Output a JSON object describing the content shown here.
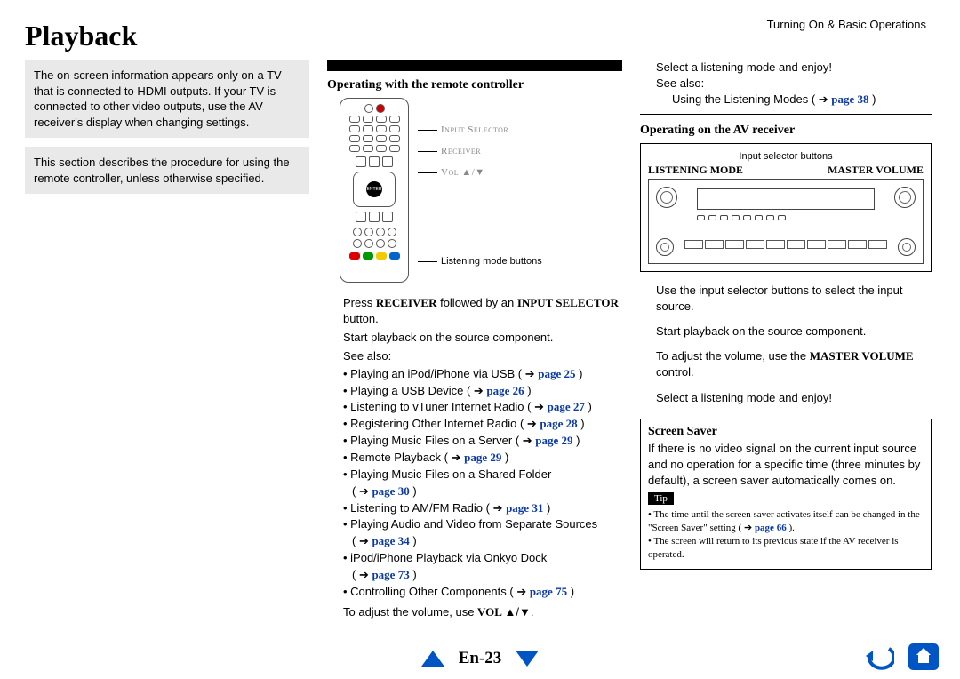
{
  "breadcrumb": "Turning On & Basic Operations",
  "title": "Playback",
  "notes": {
    "hdmi_info": "The on-screen information appears only on a TV that is connected to HDMI outputs. If your TV is connected to other video outputs, use the AV receiver's display when changing settings.",
    "procedure_intro": "This section describes the procedure for using the remote controller, unless otherwise specified."
  },
  "mid": {
    "heading": "Operating with the remote controller",
    "callouts": {
      "input_selector": "Input Selector",
      "receiver": "Receiver",
      "vol": "Vol ▲/▼",
      "listening_mode": "Listening mode buttons"
    },
    "step1_a": "Press ",
    "step1_b": "RECEIVER",
    "step1_c": " followed by an ",
    "step1_d": "INPUT SELECTOR",
    "step1_e": " button.",
    "step2": "Start playback on the source component.",
    "see_also_label": "See also:",
    "refs": [
      {
        "text": "Playing an iPod/iPhone via USB",
        "page": "page 25"
      },
      {
        "text": "Playing a USB Device",
        "page": "page 26"
      },
      {
        "text": "Listening to vTuner Internet Radio",
        "page": "page 27"
      },
      {
        "text": "Registering Other Internet Radio",
        "page": "page 28"
      },
      {
        "text": "Playing Music Files on a Server",
        "page": "page 29"
      },
      {
        "text": "Remote Playback",
        "page": "page 29"
      },
      {
        "text": "Playing Music Files on a Shared Folder",
        "page": "page 30"
      },
      {
        "text": "Listening to AM/FM Radio",
        "page": "page 31"
      },
      {
        "text": "Playing Audio and Video from Separate Sources",
        "page": "page 34"
      },
      {
        "text": "iPod/iPhone Playback via Onkyo Dock",
        "page": "page 73"
      },
      {
        "text": "Controlling Other Components",
        "page": "page 75"
      }
    ],
    "vol_a": "To adjust the volume, use ",
    "vol_b": "VOL ",
    "vol_c": "▲/▼",
    "vol_d": "."
  },
  "right": {
    "select_mode": "Select a listening mode and enjoy!",
    "see_also_label": "See also:",
    "listening_link_text": "Using the Listening Modes",
    "listening_link_page": "page 38",
    "section2_heading": "Operating on the AV receiver",
    "av_top_caption": "Input selector buttons",
    "av_left_label": "LISTENING MODE",
    "av_right_label": "MASTER VOLUME",
    "body1": "Use the input selector buttons to select the input source.",
    "body2": "Start playback on the source component.",
    "body3_a": "To adjust the volume, use the ",
    "body3_b": "MASTER VOLUME",
    "body3_c": " control.",
    "body4": "Select a listening mode and enjoy!",
    "screensaver_heading": "Screen Saver",
    "screensaver_body": "If there is no video signal on the current input source and no operation for a specific time (three minutes by default), a screen saver automatically comes on.",
    "tip_label": "Tip",
    "tip1_a": "The time until the screen saver activates itself can be changed in the \"Screen Saver\" setting",
    "tip1_page": "page 66",
    "tip2": "The screen will return to its previous state if the AV receiver is operated."
  },
  "footer": {
    "page": "En-23"
  }
}
